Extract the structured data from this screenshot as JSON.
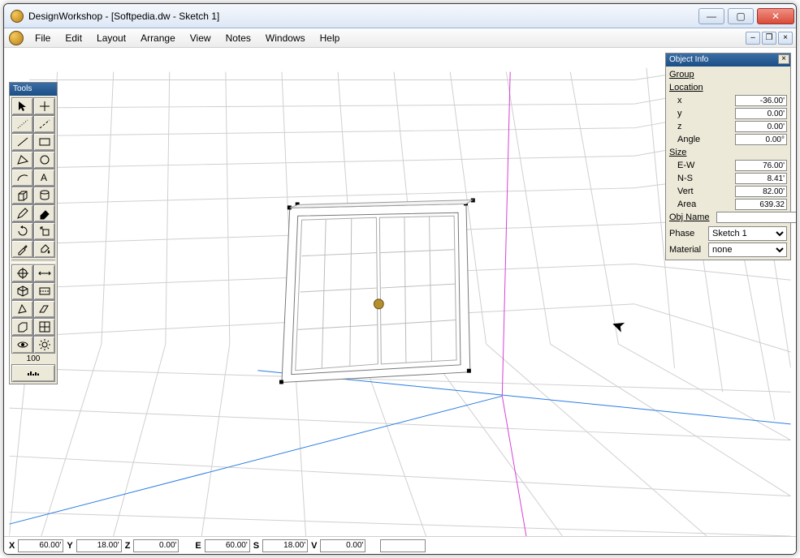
{
  "window": {
    "title": "DesignWorkshop - [Softpedia.dw - Sketch 1]"
  },
  "menu": {
    "items": [
      "File",
      "Edit",
      "Layout",
      "Arrange",
      "View",
      "Notes",
      "Windows",
      "Help"
    ]
  },
  "tools": {
    "title": "Tools",
    "value": "100"
  },
  "objectInfo": {
    "title": "Object Info",
    "group": "Group",
    "locationLabel": "Location",
    "x": {
      "label": "x",
      "value": "-36.00'"
    },
    "y": {
      "label": "y",
      "value": "0.00'"
    },
    "z": {
      "label": "z",
      "value": "0.00'"
    },
    "angle": {
      "label": "Angle",
      "value": "0.00°"
    },
    "sizeLabel": "Size",
    "ew": {
      "label": "E-W",
      "value": "76.00'"
    },
    "ns": {
      "label": "N-S",
      "value": "8.41'"
    },
    "vert": {
      "label": "Vert",
      "value": "82.00'"
    },
    "area": {
      "label": "Area",
      "value": "639.32"
    },
    "objName": {
      "label": "Obj Name",
      "value": ""
    },
    "phase": {
      "label": "Phase",
      "value": "Sketch 1"
    },
    "material": {
      "label": "Material",
      "value": "none"
    }
  },
  "status": {
    "X": "60.00'",
    "Y": "18.00'",
    "Z": "0.00'",
    "E": "60.00'",
    "S": "18.00'",
    "V": "0.00'",
    "last": ""
  }
}
